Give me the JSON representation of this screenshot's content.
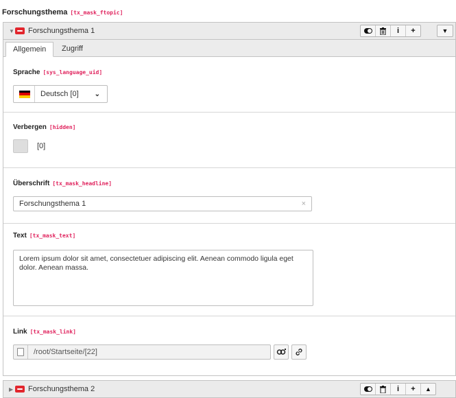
{
  "section": {
    "title": "Forschungsthema",
    "code": "[tx_mask_ftopic]"
  },
  "panel1": {
    "title": "Forschungsthema 1",
    "tabs": [
      "Allgemein",
      "Zugriff"
    ],
    "fields": {
      "sprache": {
        "label": "Sprache",
        "code": "[sys_language_uid]",
        "value": "Deutsch [0]"
      },
      "verbergen": {
        "label": "Verbergen",
        "code": "[hidden]",
        "value": "[0]"
      },
      "ueberschrift": {
        "label": "Überschrift",
        "code": "[tx_mask_headline]",
        "value": "Forschungsthema 1"
      },
      "text": {
        "label": "Text",
        "code": "[tx_mask_text]",
        "value": "Lorem ipsum dolor sit amet, consectetuer adipiscing elit. Aenean commodo ligula eget dolor. Aenean massa."
      },
      "link": {
        "label": "Link",
        "code": "[tx_mask_link]",
        "value": "/root/Startseite/[22]"
      }
    }
  },
  "panel2": {
    "title": "Forschungsthema 2"
  },
  "icons": {
    "toggle": "toggle-icon",
    "delete": "trash-icon",
    "info": "i",
    "add": "+",
    "collapse": "▼",
    "up": "▲",
    "clear": "×"
  },
  "colors": {
    "code": "#e0245e",
    "mask_logo": "#e2262d",
    "panel_header": "#ebebeb"
  }
}
